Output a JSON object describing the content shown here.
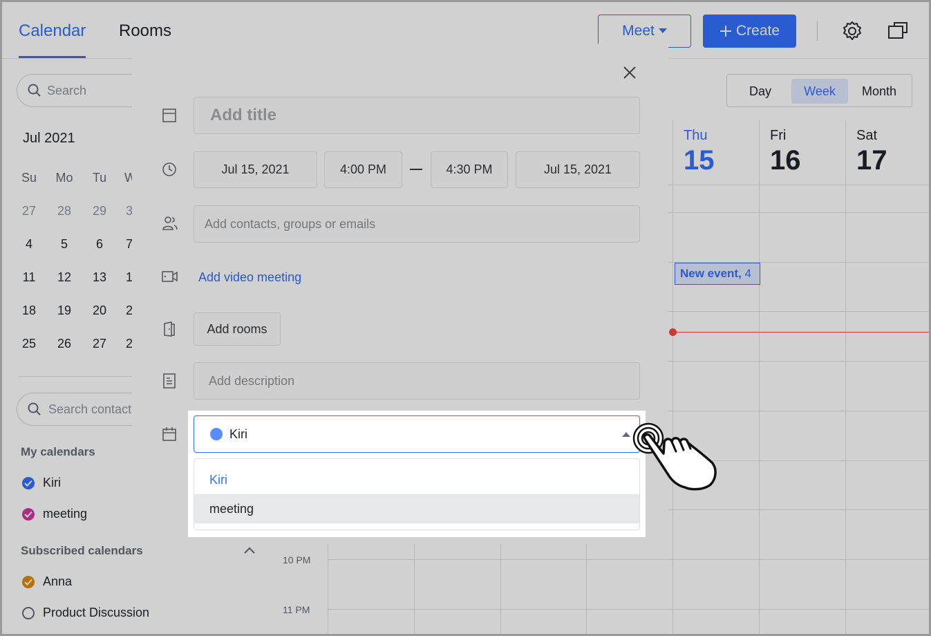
{
  "header": {
    "tabs": [
      {
        "label": "Calendar",
        "active": true
      },
      {
        "label": "Rooms",
        "active": false
      }
    ],
    "meet_label": "Meet",
    "create_label": "Create"
  },
  "sidebar": {
    "search_placeholder": "Search",
    "month_title": "Jul 2021",
    "weekday_heads": [
      "Su",
      "Mo",
      "Tu",
      "W"
    ],
    "weeks": [
      [
        "27",
        "28",
        "29",
        "3"
      ],
      [
        "4",
        "5",
        "6",
        "7"
      ],
      [
        "11",
        "12",
        "13",
        "1"
      ],
      [
        "18",
        "19",
        "20",
        "2"
      ],
      [
        "25",
        "26",
        "27",
        "2"
      ]
    ],
    "search_contacts_placeholder": "Search contact",
    "my_calendars_title": "My calendars",
    "my_calendars": [
      {
        "label": "Kiri",
        "color": "#3370ff"
      },
      {
        "label": "meeting",
        "color": "#d136a4"
      }
    ],
    "subscribed_title": "Subscribed calendars",
    "subscribed": [
      {
        "label": "Anna",
        "color": "#e08a00",
        "checked": true
      },
      {
        "label": "Product Discussion",
        "checked": false
      }
    ]
  },
  "view_switch": {
    "day": "Day",
    "week": "Week",
    "month": "Month",
    "active": "Week"
  },
  "days": [
    {
      "name": "Thu",
      "num": "15",
      "today": true
    },
    {
      "name": "Fri",
      "num": "16",
      "today": false
    },
    {
      "name": "Sat",
      "num": "17",
      "today": false
    }
  ],
  "time_labels": [
    "10 PM",
    "11 PM"
  ],
  "new_event": {
    "title": "New event,",
    "time": "4"
  },
  "modal": {
    "title_placeholder": "Add title",
    "start_date": "Jul 15, 2021",
    "start_time": "4:00 PM",
    "end_time": "4:30 PM",
    "end_date": "Jul 15, 2021",
    "contacts_placeholder": "Add contacts, groups or emails",
    "video_link": "Add video meeting",
    "rooms_button": "Add rooms",
    "description_placeholder": "Add description",
    "calendar_select": {
      "selected": "Kiri",
      "color": "#5b8cff"
    },
    "dropdown_options": [
      "Kiri",
      "meeting"
    ]
  }
}
